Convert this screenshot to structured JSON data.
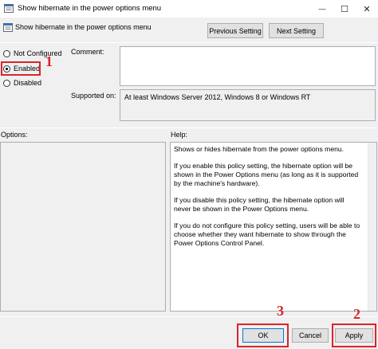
{
  "window": {
    "title": "Show hibernate in the power options menu",
    "minimize_glyph": "—",
    "maximize_glyph": "☐",
    "close_glyph": "✕"
  },
  "policy": {
    "name": "Show hibernate in the power options menu",
    "previous_label": "Previous Setting",
    "next_label": "Next Setting"
  },
  "state": {
    "options": [
      {
        "label": "Not Configured",
        "checked": false
      },
      {
        "label": "Enabled",
        "checked": true
      },
      {
        "label": "Disabled",
        "checked": false
      }
    ]
  },
  "comment": {
    "label": "Comment:",
    "value": ""
  },
  "supported": {
    "label": "Supported on:",
    "value": "At least Windows Server 2012, Windows 8 or Windows RT"
  },
  "options_panel": {
    "label": "Options:"
  },
  "help_panel": {
    "label": "Help:",
    "paragraphs": [
      "Shows or hides hibernate from the power options menu.",
      "If you enable this policy setting, the hibernate option will be shown in the Power Options menu (as long as it is supported by the machine's hardware).",
      "If you disable this policy setting, the hibernate option will never be shown in the Power Options menu.",
      "If you do not configure this policy setting, users will be able to choose whether they want hibernate to show through the Power Options Control Panel."
    ]
  },
  "footer": {
    "ok_label": "OK",
    "cancel_label": "Cancel",
    "apply_label": "Apply"
  },
  "annotations": {
    "enabled_marker": "1",
    "apply_marker": "2",
    "ok_marker": "3",
    "color": "#d9252a"
  },
  "icons": {
    "app": "policy-icon",
    "window_controls": [
      "minimize-icon",
      "maximize-icon",
      "close-icon"
    ]
  }
}
